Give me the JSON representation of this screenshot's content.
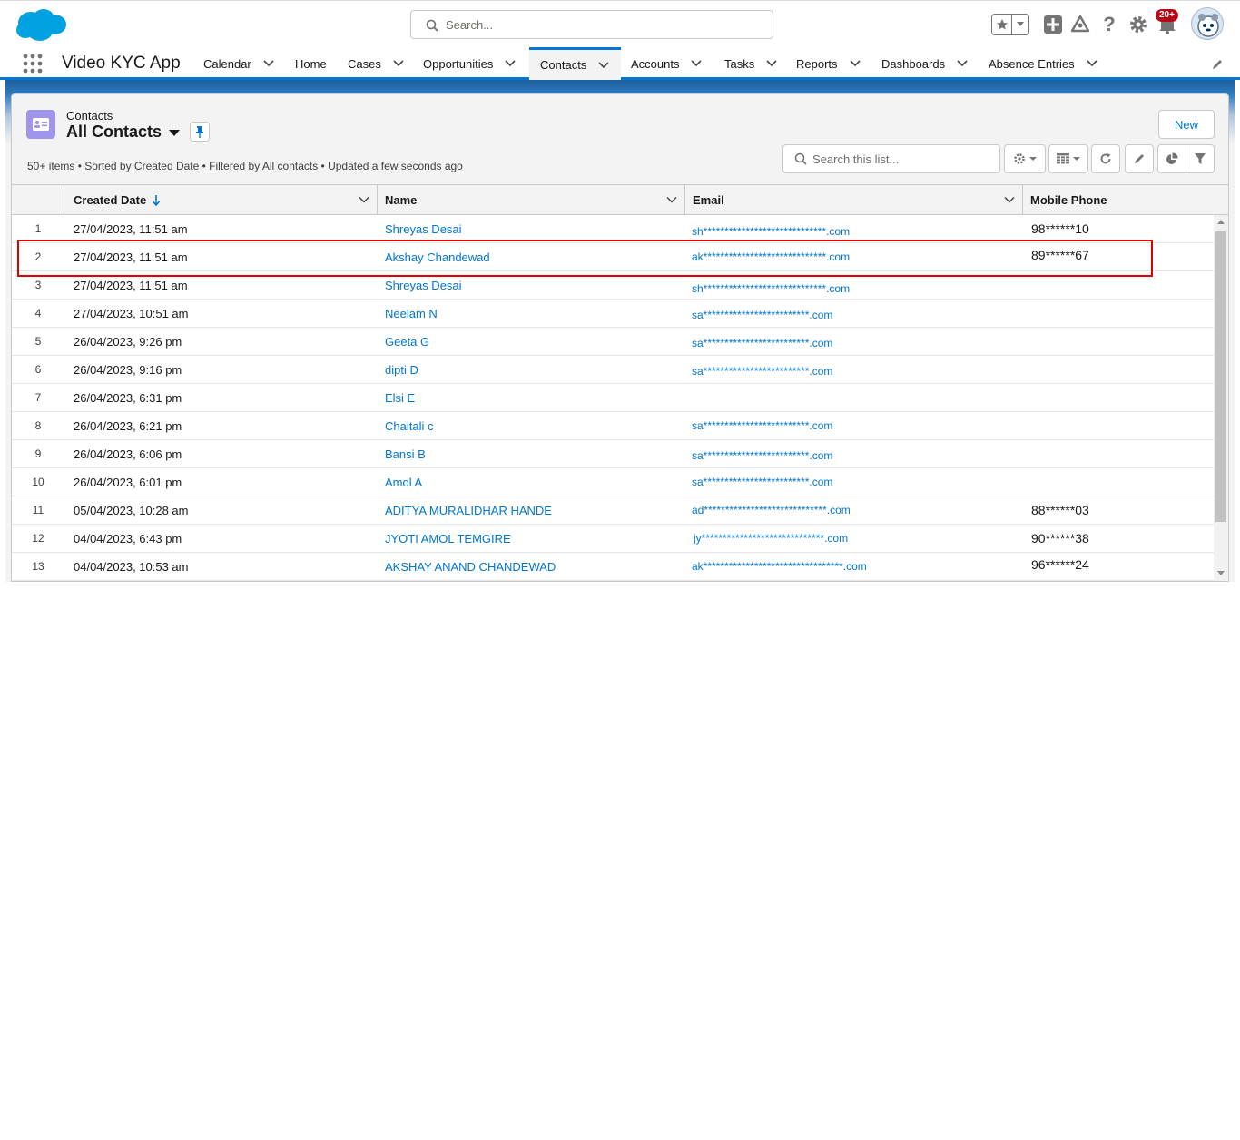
{
  "header": {
    "search_placeholder": "Search...",
    "notification_count": "20+"
  },
  "nav": {
    "app_name": "Video KYC App",
    "items": [
      {
        "label": "Calendar",
        "has_menu": true
      },
      {
        "label": "Home",
        "has_menu": false
      },
      {
        "label": "Cases",
        "has_menu": true
      },
      {
        "label": "Opportunities",
        "has_menu": true
      },
      {
        "label": "Contacts",
        "has_menu": true,
        "active": true
      },
      {
        "label": "Accounts",
        "has_menu": true
      },
      {
        "label": "Tasks",
        "has_menu": true
      },
      {
        "label": "Reports",
        "has_menu": true
      },
      {
        "label": "Dashboards",
        "has_menu": true
      },
      {
        "label": "Absence Entries",
        "has_menu": true
      }
    ]
  },
  "list": {
    "object_label": "Contacts",
    "view_name": "All Contacts",
    "new_label": "New",
    "info": "50+ items • Sorted by Created Date • Filtered by All contacts • Updated a few seconds ago",
    "search_placeholder": "Search this list..."
  },
  "table": {
    "columns": [
      "Created Date",
      "Name",
      "Email",
      "Mobile Phone"
    ],
    "rows": [
      {
        "num": "1",
        "date": "27/04/2023, 11:51 am",
        "name": "Shreyas Desai",
        "email": "sh*****************************.com",
        "phone": "98******10"
      },
      {
        "num": "2",
        "date": "27/04/2023, 11:51 am",
        "name": "Akshay Chandewad",
        "email": "ak*****************************.com",
        "phone": "89******67"
      },
      {
        "num": "3",
        "date": "27/04/2023, 11:51 am",
        "name": "Shreyas Desai",
        "email": "sh*****************************.com",
        "phone": ""
      },
      {
        "num": "4",
        "date": "27/04/2023, 10:51 am",
        "name": "Neelam N",
        "email": "sa*************************.com",
        "phone": ""
      },
      {
        "num": "5",
        "date": "26/04/2023, 9:26 pm",
        "name": "Geeta G",
        "email": "sa*************************.com",
        "phone": ""
      },
      {
        "num": "6",
        "date": "26/04/2023, 9:16 pm",
        "name": "dipti D",
        "email": "sa*************************.com",
        "phone": ""
      },
      {
        "num": "7",
        "date": "26/04/2023, 6:31 pm",
        "name": "Elsi E",
        "email": "",
        "phone": ""
      },
      {
        "num": "8",
        "date": "26/04/2023, 6:21 pm",
        "name": "Chaitali c",
        "email": "sa*************************.com",
        "phone": ""
      },
      {
        "num": "9",
        "date": "26/04/2023, 6:06 pm",
        "name": "Bansi B",
        "email": "sa*************************.com",
        "phone": ""
      },
      {
        "num": "10",
        "date": "26/04/2023, 6:01 pm",
        "name": "Amol A",
        "email": "sa*************************.com",
        "phone": ""
      },
      {
        "num": "11",
        "date": "05/04/2023, 10:28 am",
        "name": "ADITYA MURALIDHAR HANDE",
        "email": "ad*****************************.com",
        "phone": "88******03"
      },
      {
        "num": "12",
        "date": "04/04/2023, 6:43 pm",
        "name": "JYOTI AMOL TEMGIRE",
        "email": "jy*****************************.com",
        "phone": "90******38"
      },
      {
        "num": "13",
        "date": "04/04/2023, 10:53 am",
        "name": "AKSHAY ANAND CHANDEWAD",
        "email": "ak*********************************.com",
        "phone": "96******24"
      }
    ]
  },
  "colors": {
    "brand": "#0176d3",
    "link": "#0176d3",
    "highlight": "#e00000",
    "contact_icon": "#a094ed",
    "badge": "#ba0517"
  }
}
